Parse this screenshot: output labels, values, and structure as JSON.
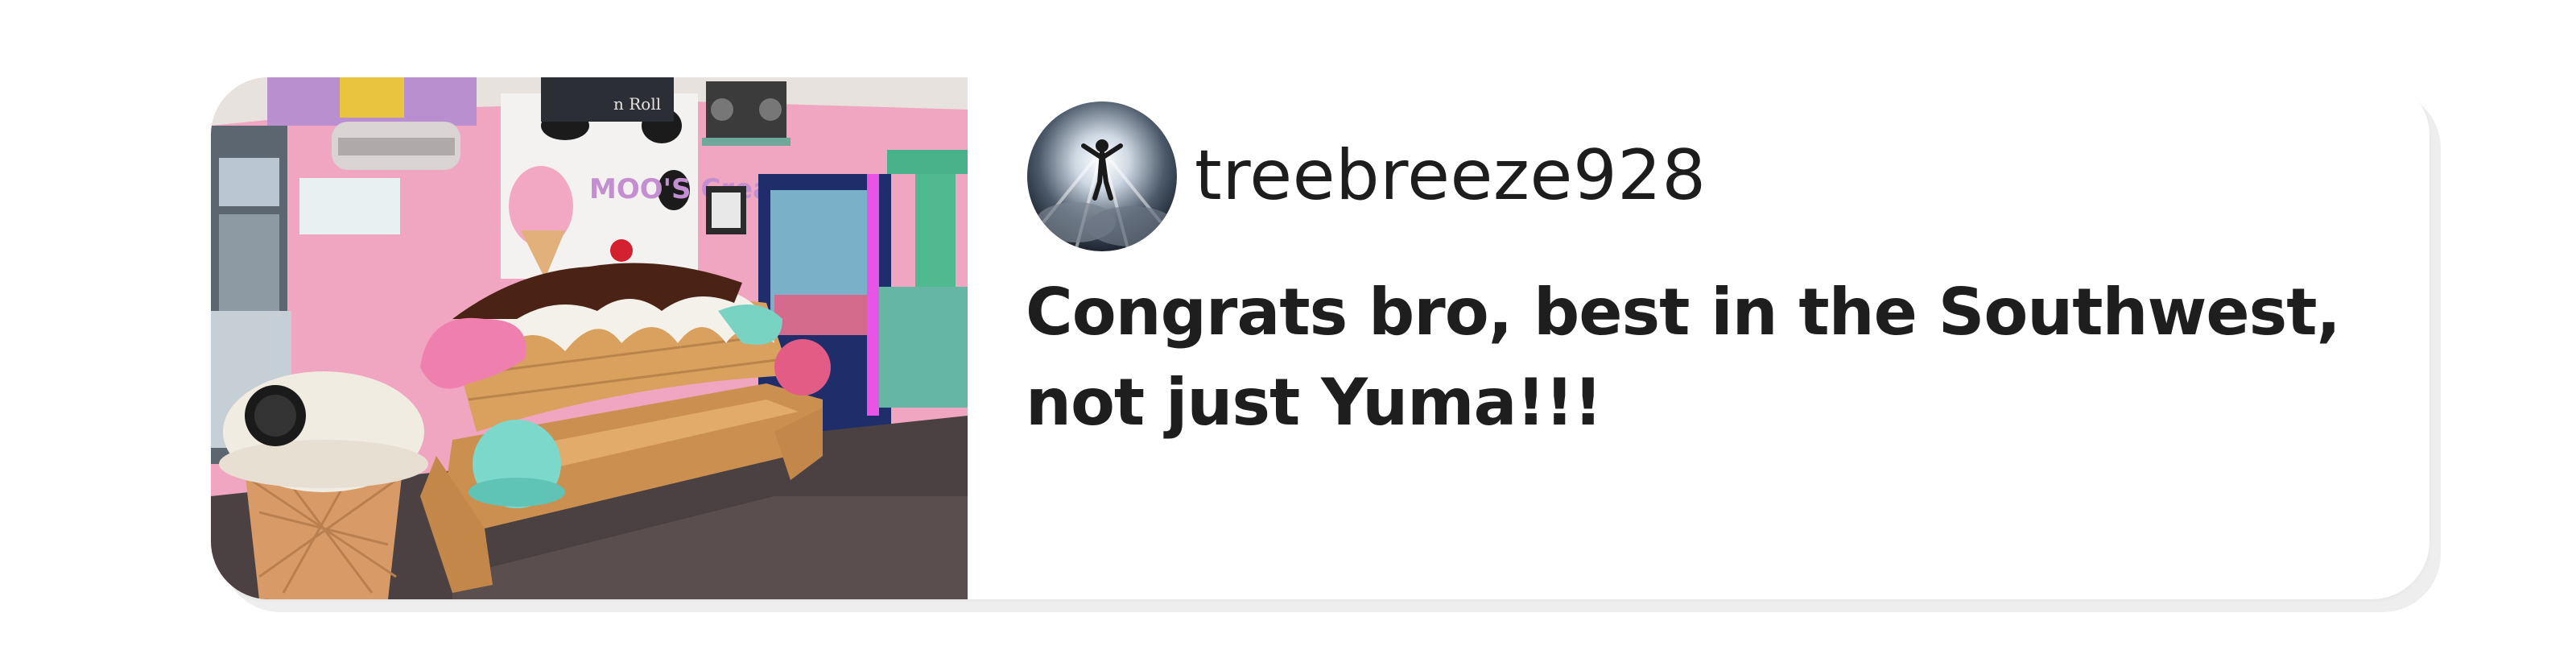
{
  "comment": {
    "username": "treebreeze928",
    "text": "Congrats bro, best in the Southwest, not just Yuma!!!",
    "avatar_icon": "person-in-light-avatar",
    "photo_description_icon": "ice-cream-shop-bench-photo"
  },
  "photo": {
    "sign_text": "MOO'S Creamery",
    "sign_text_small": "n Roll"
  },
  "colors": {
    "card_background": "#ffffff",
    "text": "#1e1e1e",
    "wall_pink": "#f3a9c2"
  }
}
